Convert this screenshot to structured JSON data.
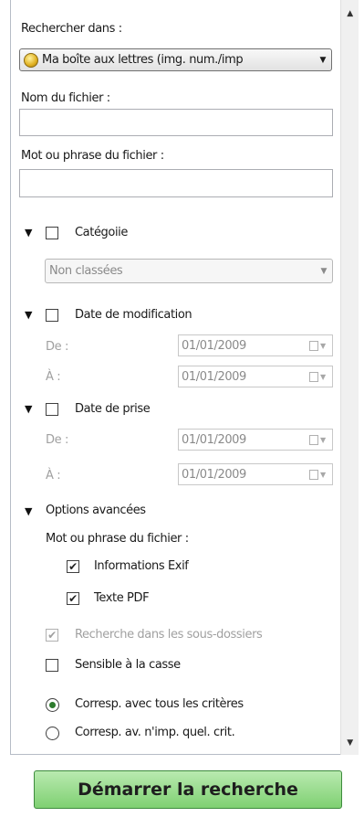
{
  "search_in": {
    "label": "Rechercher dans :",
    "selected": "Ma boîte aux lettres (img. num./imp"
  },
  "filename": {
    "label": "Nom du fichier :",
    "value": ""
  },
  "word": {
    "label": "Mot ou phrase du fichier :",
    "value": ""
  },
  "category": {
    "label": "Catégoiie",
    "checked": false,
    "selected": "Non classées"
  },
  "date_modified": {
    "label": "Date de modification",
    "checked": false,
    "from_label": "De :",
    "to_label": "À :",
    "from_value": "01/01/2009",
    "to_value": "01/01/2009"
  },
  "date_taken": {
    "label": "Date de prise",
    "checked": false,
    "from_label": "De :",
    "to_label": "À :",
    "from_value": "01/01/2009",
    "to_value": "01/01/2009"
  },
  "advanced": {
    "label": "Options avancées",
    "word_label": "Mot ou phrase du fichier :",
    "exif_label": "Informations Exif",
    "exif_checked": true,
    "pdf_label": "Texte PDF",
    "pdf_checked": true,
    "subfolders_label": "Recherche dans les sous-dossiers",
    "subfolders_checked": true,
    "case_label": "Sensible à la casse",
    "case_checked": false,
    "match_all_label": "Corresp. avec tous les critères",
    "match_any_label": "Corresp. av. n'imp. quel. crit.",
    "match_selected": "all"
  },
  "start_button": "Démarrer la recherche",
  "icons": {
    "mailbox": "mailbox-icon",
    "expand": "triangle-down-icon",
    "calendar": "calendar-icon",
    "scroll_up": "scroll-up-arrow-icon",
    "scroll_down": "scroll-down-arrow-icon"
  },
  "colors": {
    "start_button": "#8fd884",
    "radio_dot": "#2d7a2d"
  }
}
